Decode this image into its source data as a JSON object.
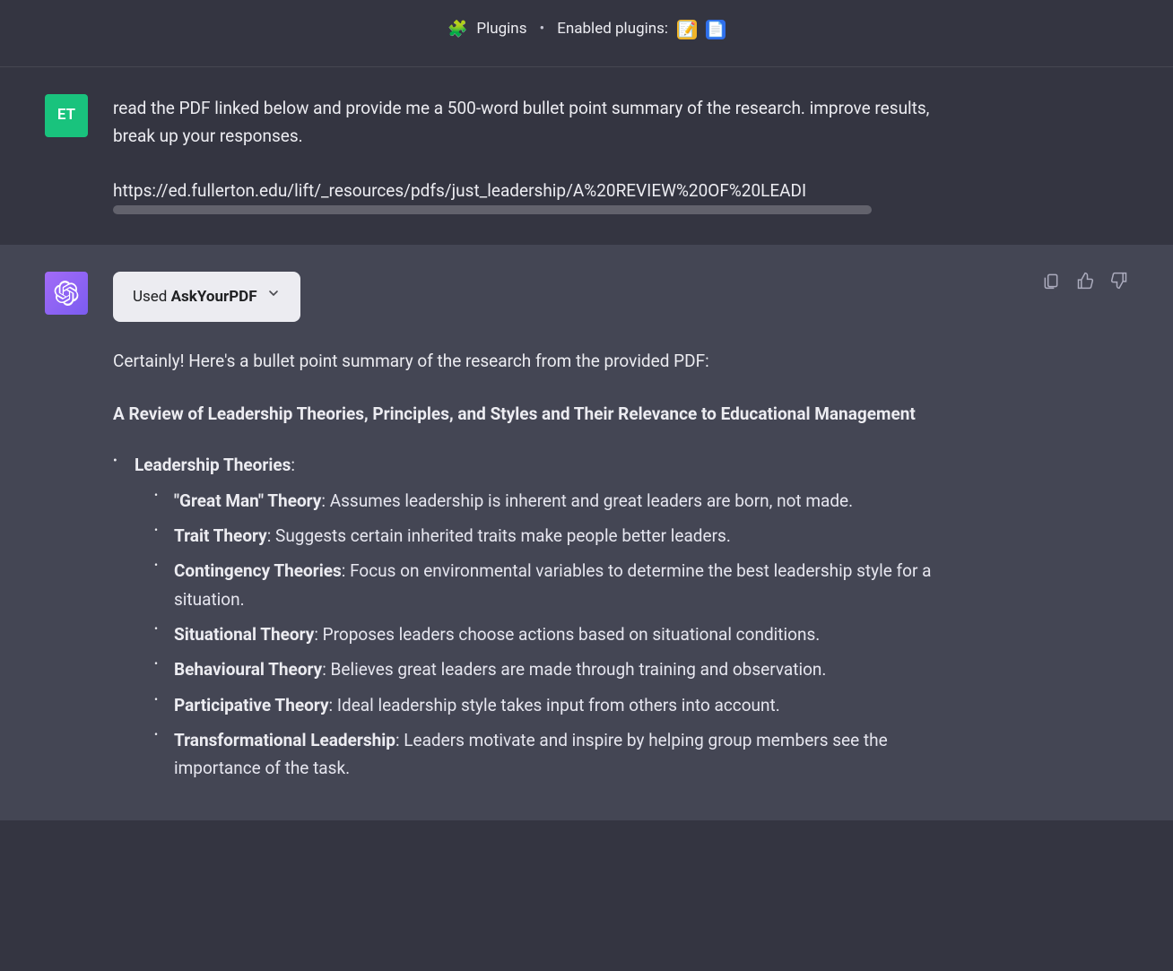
{
  "header": {
    "plugins_label": "Plugins",
    "enabled_label": "Enabled plugins:"
  },
  "user": {
    "avatar": "ET",
    "prompt": "read the PDF linked below and provide me a 500-word bullet point summary of the research. improve results, break up your responses.",
    "url": "https://ed.fullerton.edu/lift/_resources/pdfs/just_leadership/A%20REVIEW%20OF%20LEADI"
  },
  "assistant": {
    "plugin_chip_prefix": "Used ",
    "plugin_chip_name": "AskYourPDF",
    "intro": "Certainly! Here's a bullet point summary of the research from the provided PDF:",
    "title": "A Review of Leadership Theories, Principles, and Styles and Their Relevance to Educational Management",
    "section": {
      "heading": "Leadership Theories",
      "heading_suffix": ":",
      "items": [
        {
          "name": "\"Great Man\" Theory",
          "text": ": Assumes leadership is inherent and great leaders are born, not made."
        },
        {
          "name": "Trait Theory",
          "text": ": Suggests certain inherited traits make people better leaders."
        },
        {
          "name": "Contingency Theories",
          "text": ": Focus on environmental variables to determine the best leadership style for a situation."
        },
        {
          "name": "Situational Theory",
          "text": ": Proposes leaders choose actions based on situational conditions."
        },
        {
          "name": "Behavioural Theory",
          "text": ": Believes great leaders are made through training and observation."
        },
        {
          "name": "Participative Theory",
          "text": ": Ideal leadership style takes input from others into account."
        },
        {
          "name": "Transformational Leadership",
          "text": ": Leaders motivate and inspire by helping group members see the importance of the task."
        }
      ]
    }
  }
}
